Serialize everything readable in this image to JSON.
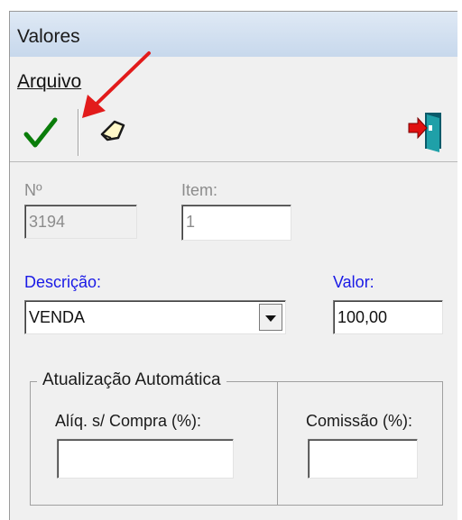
{
  "window": {
    "title": "Valores"
  },
  "menu": {
    "items": [
      {
        "label": "Arquivo"
      }
    ]
  },
  "toolbar": {
    "buttons": [
      {
        "icon": "checkmark-icon",
        "color": "#0a7d0a"
      },
      {
        "icon": "eraser-icon"
      },
      {
        "icon": "exit-door-icon",
        "color": "#e01010"
      }
    ]
  },
  "annotation": {
    "arrow_color": "#e21b1b"
  },
  "form": {
    "numero": {
      "label": "Nº",
      "value": "3194"
    },
    "item": {
      "label": "Item:",
      "value": "1"
    },
    "descricao": {
      "label": "Descrição:",
      "value": "VENDA"
    },
    "valor": {
      "label": "Valor:",
      "value": "100,00"
    },
    "atualizacao": {
      "title": "Atualização Automática",
      "aliquota": {
        "label": "Alíq. s/ Compra (%):",
        "value": ""
      },
      "comissao": {
        "label": "Comissão (%):",
        "value": ""
      }
    }
  }
}
